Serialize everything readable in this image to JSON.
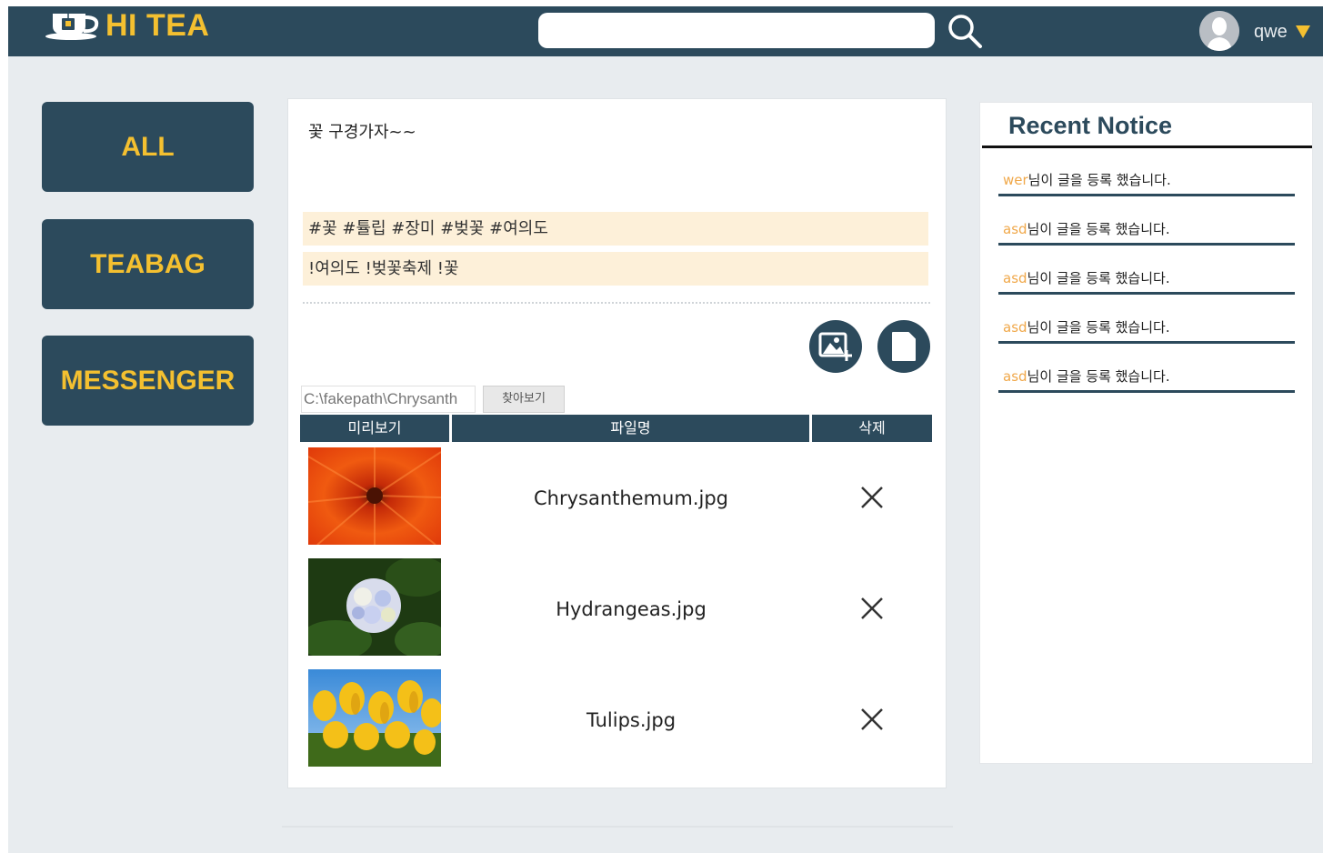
{
  "header": {
    "logo_text": "HI TEA",
    "search_placeholder": "",
    "search_icon": "search-icon",
    "user_name": "qwe",
    "colors": {
      "bar": "#2c4a5c",
      "accent": "#f4c030"
    }
  },
  "sidebar": {
    "items": [
      {
        "label": "ALL"
      },
      {
        "label": "TEABAG"
      },
      {
        "label": "MESSENGER"
      }
    ]
  },
  "post": {
    "text": "꽃 구경가자~~",
    "hashtags": "#꽃 #튤립 #장미 #벚꽃 #여의도",
    "keywords": "!여의도 !벚꽃축제 !꽃",
    "add_image_icon": "add-image-icon",
    "add_file_icon": "file-icon",
    "file_path": "C:\\fakepath\\Chrysanth",
    "browse_label": "찾아보기",
    "table": {
      "headers": [
        "미리보기",
        "파일명",
        "삭제"
      ],
      "rows": [
        {
          "filename": "Chrysanthemum.jpg",
          "thumbnail": "orange-flower"
        },
        {
          "filename": "Hydrangeas.jpg",
          "thumbnail": "hydrangea-flower"
        },
        {
          "filename": "Tulips.jpg",
          "thumbnail": "yellow-tulips"
        }
      ]
    }
  },
  "notice": {
    "title": "Recent Notice",
    "items": [
      {
        "user": "wer",
        "message": "님이 글을 등록 했습니다."
      },
      {
        "user": "asd",
        "message": "님이 글을 등록 했습니다."
      },
      {
        "user": "asd",
        "message": "님이 글을 등록 했습니다."
      },
      {
        "user": "asd",
        "message": "님이 글을 등록 했습니다."
      },
      {
        "user": "asd",
        "message": "님이 글을 등록 했습니다."
      }
    ],
    "colors": {
      "user": "#f0a84a",
      "rule": "#2c4a5c"
    }
  }
}
